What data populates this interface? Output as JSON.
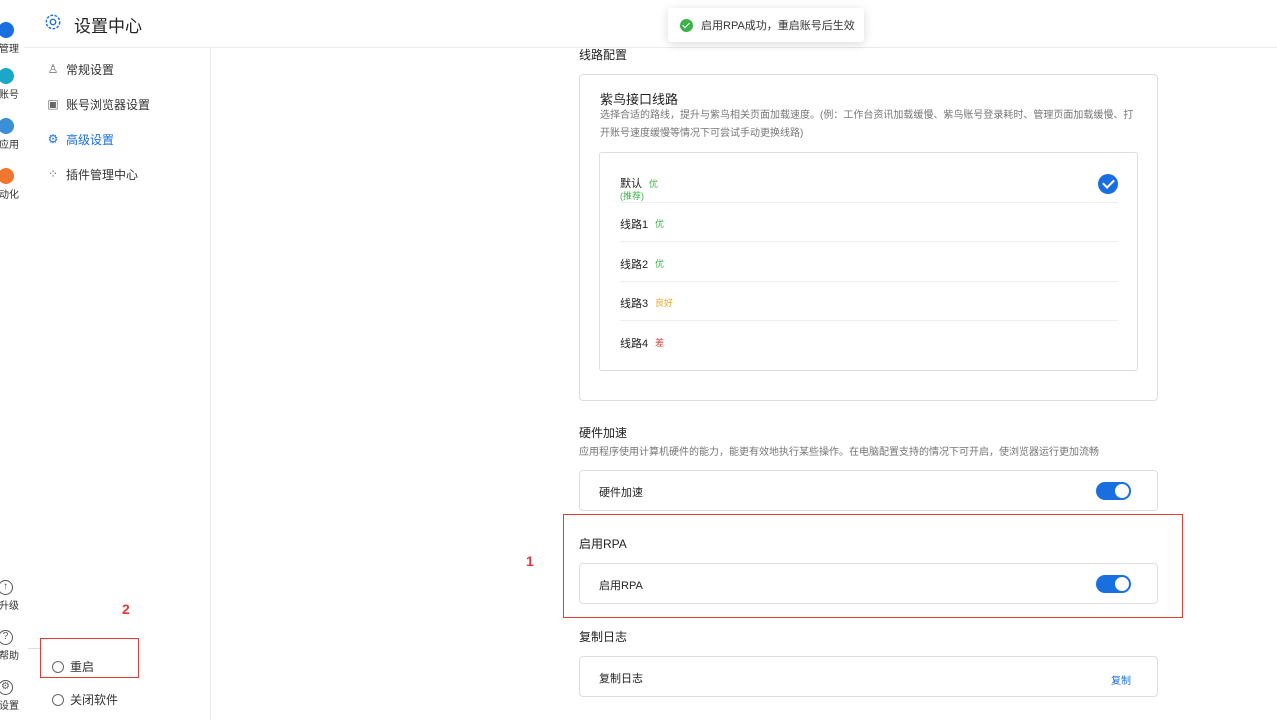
{
  "rail": {
    "items": [
      {
        "label": "管理",
        "color": "#1a6fe0"
      },
      {
        "label": "账号",
        "color": "#1aa7c9"
      },
      {
        "label": "应用",
        "color": "#3b8fd6"
      },
      {
        "label": "动化",
        "color": "#f2762e"
      }
    ],
    "bottom": [
      {
        "label": "升级"
      },
      {
        "label": "帮助"
      },
      {
        "label": "设置"
      }
    ]
  },
  "header": {
    "title": "设置中心"
  },
  "toast": {
    "text": "启用RPA成功，重启账号后生效"
  },
  "sidebar": {
    "items": [
      {
        "label": "常规设置",
        "icon": "user-icon"
      },
      {
        "label": "账号浏览器设置",
        "icon": "browser-icon"
      },
      {
        "label": "高级设置",
        "icon": "advanced-icon"
      },
      {
        "label": "插件管理中心",
        "icon": "grid-icon"
      }
    ],
    "restart_label": "重启",
    "close_label": "关闭软件"
  },
  "annotations": {
    "num1": "1",
    "num2": "2"
  },
  "routes_section": {
    "title": "线路配置",
    "card_title": "紫鸟接口线路",
    "card_desc": "选择合适的路线，提升与紫鸟相关页面加载速度。(例：工作台资讯加载缓慢、紫鸟账号登录耗时、管理页面加载缓慢、打开账号速度缓慢等情况下可尝试手动更换线路)",
    "routes": [
      {
        "name": "默认",
        "quality": "优",
        "sub": "(推荐)",
        "quality_color": "#3bb349",
        "selected": true
      },
      {
        "name": "线路1",
        "quality": "优",
        "quality_color": "#3bb349"
      },
      {
        "name": "线路2",
        "quality": "优",
        "quality_color": "#3bb349"
      },
      {
        "name": "线路3",
        "quality": "良好",
        "quality_color": "#f5a623"
      },
      {
        "name": "线路4",
        "quality": "差",
        "quality_color": "#e53935"
      }
    ]
  },
  "hardware": {
    "title": "硬件加速",
    "desc": "应用程序使用计算机硬件的能力，能更有效地执行某些操作。在电脑配置支持的情况下可开启，使浏览器运行更加流畅",
    "row_label": "硬件加速",
    "enabled": true
  },
  "rpa": {
    "title": "启用RPA",
    "row_label": "启用RPA",
    "enabled": true
  },
  "log": {
    "title": "复制日志",
    "row_label": "复制日志",
    "copy_label": "复制"
  }
}
